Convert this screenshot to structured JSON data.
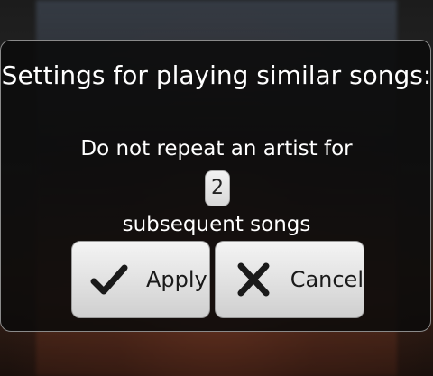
{
  "dialog": {
    "title": "Settings for playing similar songs:",
    "message": "Do not repeat an artist for",
    "repeat_value": "2",
    "suffix": "subsequent songs",
    "apply_label": "Apply",
    "cancel_label": "Cancel"
  },
  "icons": {
    "apply": "checkmark-icon",
    "cancel": "close-x-icon"
  }
}
